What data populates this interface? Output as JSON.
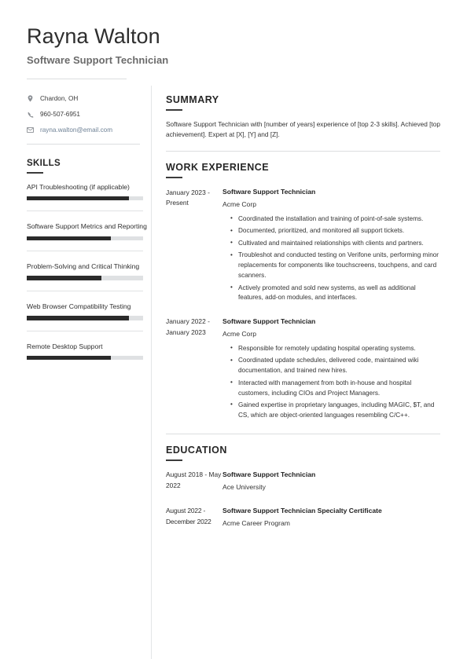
{
  "header": {
    "full_name": "Rayna Walton",
    "job_title": "Software Support Technician"
  },
  "contact": {
    "location": "Chardon, OH",
    "phone": "960-507-6951",
    "email": "rayna.walton@email.com",
    "icons": {
      "location": "location-pin-icon",
      "phone": "phone-icon",
      "email": "envelope-icon"
    },
    "email_color": "#6f8296"
  },
  "skills": {
    "title": "SKILLS",
    "items": [
      {
        "label": "API Troubleshooting (if applicable)",
        "level": 88
      },
      {
        "label": "Software Support Metrics and Reporting",
        "level": 72
      },
      {
        "label": "Problem-Solving and Critical Thinking",
        "level": 64
      },
      {
        "label": "Web Browser Compatibility Testing",
        "level": 88
      },
      {
        "label": "Remote Desktop Support",
        "level": 72
      }
    ],
    "bar_fill_color": "#2b2b2b",
    "bar_track_color": "#dfe1e3"
  },
  "summary": {
    "title": "SUMMARY",
    "text": "Software Support Technician with [number of years] experience of [top 2-3 skills]. Achieved [top achievement]. Expert at [X], [Y] and [Z]."
  },
  "work_experience": {
    "title": "WORK EXPERIENCE",
    "entries": [
      {
        "dates": "January 2023 - Present",
        "role": "Software Support Technician",
        "organization": "Acme Corp",
        "bullets": [
          "Coordinated the installation and training of point-of-sale systems.",
          "Documented, prioritized, and monitored all support tickets.",
          "Cultivated and maintained relationships with clients and partners.",
          "Troubleshot and conducted testing on Verifone units, performing minor replacements for components like touchscreens, touchpens, and card scanners.",
          "Actively promoted and sold new systems, as well as additional features, add-on modules, and interfaces."
        ]
      },
      {
        "dates": "January 2022 - January 2023",
        "role": "Software Support Technician",
        "organization": "Acme Corp",
        "bullets": [
          "Responsible for remotely updating hospital operating systems.",
          "Coordinated update schedules, delivered code, maintained wiki documentation, and trained new hires.",
          "Interacted with management from both in-house and hospital customers, including CIOs and Project Managers.",
          "Gained expertise in proprietary languages, including MAGIC, $T, and CS, which are object-oriented languages resembling C/C++."
        ]
      }
    ]
  },
  "education": {
    "title": "EDUCATION",
    "entries": [
      {
        "dates": "August 2018 - May 2022",
        "degree": "Software Support Technician",
        "institution": "Ace University"
      },
      {
        "dates": "August 2022 - December 2022",
        "degree": "Software Support Technician Specialty Certificate",
        "institution": "Acme Career Program"
      }
    ]
  }
}
